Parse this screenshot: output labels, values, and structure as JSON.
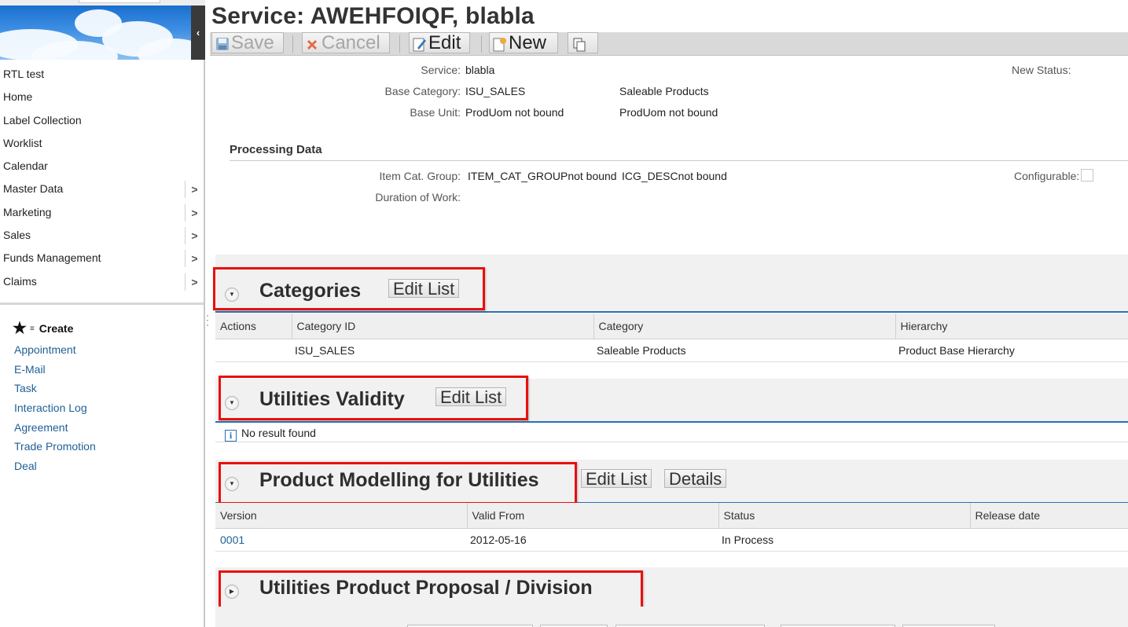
{
  "nav": {
    "items": [
      {
        "label": "RTL test",
        "has_submenu": false
      },
      {
        "label": "Home",
        "has_submenu": false
      },
      {
        "label": "Label Collection",
        "has_submenu": false
      },
      {
        "label": "Worklist",
        "has_submenu": false
      },
      {
        "label": "Calendar",
        "has_submenu": false
      },
      {
        "label": "Master Data",
        "has_submenu": true
      },
      {
        "label": "Marketing",
        "has_submenu": true
      },
      {
        "label": "Sales",
        "has_submenu": true
      },
      {
        "label": "Funds Management",
        "has_submenu": true
      },
      {
        "label": "Claims",
        "has_submenu": true
      }
    ],
    "chevron": ">",
    "collapse_glyph": "‹"
  },
  "create": {
    "title": "Create",
    "icon": "star-icon",
    "links": [
      "Appointment",
      "E-Mail",
      "Task",
      "Interaction Log",
      "Agreement",
      "Trade Promotion",
      "Deal"
    ]
  },
  "page": {
    "title": "Service: AWEHFOIQF, blabla"
  },
  "toolbar": {
    "save": "Save",
    "cancel": "Cancel",
    "edit": "Edit",
    "new": "New"
  },
  "header": {
    "service_label": "Service:",
    "service_value": "blabla",
    "new_status_label": "New Status:",
    "base_category_label": "Base Category:",
    "base_category_value": "ISU_SALES",
    "base_category_desc": "Saleable Products",
    "base_unit_label": "Base Unit:",
    "base_unit_value": "ProdUom not bound",
    "base_unit_desc": "ProdUom not bound"
  },
  "processing": {
    "title": "Processing Data",
    "item_cat_label": "Item Cat. Group:",
    "item_cat_value": "ITEM_CAT_GROUPnot bound",
    "item_cat_desc": "ICG_DESCnot bound",
    "configurable_label": "Configurable:",
    "duration_label": "Duration of Work:"
  },
  "categories": {
    "title": "Categories",
    "edit_list": "Edit List",
    "columns": [
      "Actions",
      "Category ID",
      "Category",
      "Hierarchy"
    ],
    "rows": [
      {
        "actions": "",
        "category_id": "ISU_SALES",
        "category": "Saleable Products",
        "hierarchy": "Product Base Hierarchy"
      }
    ]
  },
  "validity": {
    "title": "Utilities Validity",
    "edit_list": "Edit List",
    "empty_text": "No result found"
  },
  "modelling": {
    "title": "Product Modelling for Utilities",
    "edit_list": "Edit List",
    "details": "Details",
    "columns": [
      "Version",
      "Valid From",
      "Status",
      "Release date"
    ],
    "rows": [
      {
        "version": "0001",
        "valid_from": "2012-05-16",
        "status": "In Process",
        "release_date": ""
      }
    ]
  },
  "proposal": {
    "title": "Utilities Product Proposal / Division"
  },
  "colors": {
    "accent": "#2a6fb5",
    "link": "#1f5f95",
    "highlight": "#e8100e"
  }
}
